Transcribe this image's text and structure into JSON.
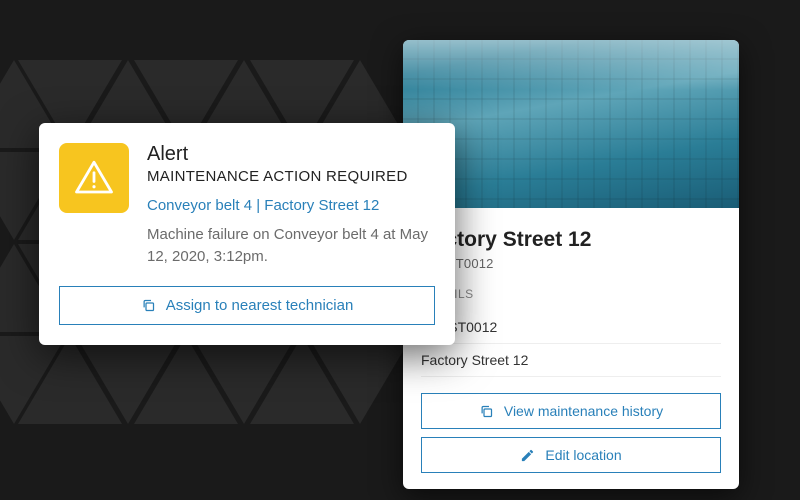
{
  "alert": {
    "title": "Alert",
    "subtitle": "MAINTENANCE ACTION REQUIRED",
    "location_line": "Conveyor belt 4 | Factory Street 12",
    "description": "Machine failure on Conveyor belt 4 at May 12, 2020, 3:12pm.",
    "assign_label": "Assign to nearest technician"
  },
  "location": {
    "title": "Factory Street 12",
    "code": "FACST0012",
    "section_label": "DETAILS",
    "rows": [
      "FACST0012",
      "Factory Street 12"
    ],
    "actions": {
      "view_history_label": "View maintenance history",
      "edit_label": "Edit location"
    }
  },
  "colors": {
    "accent": "#2980b9",
    "warning": "#f7c51f"
  }
}
